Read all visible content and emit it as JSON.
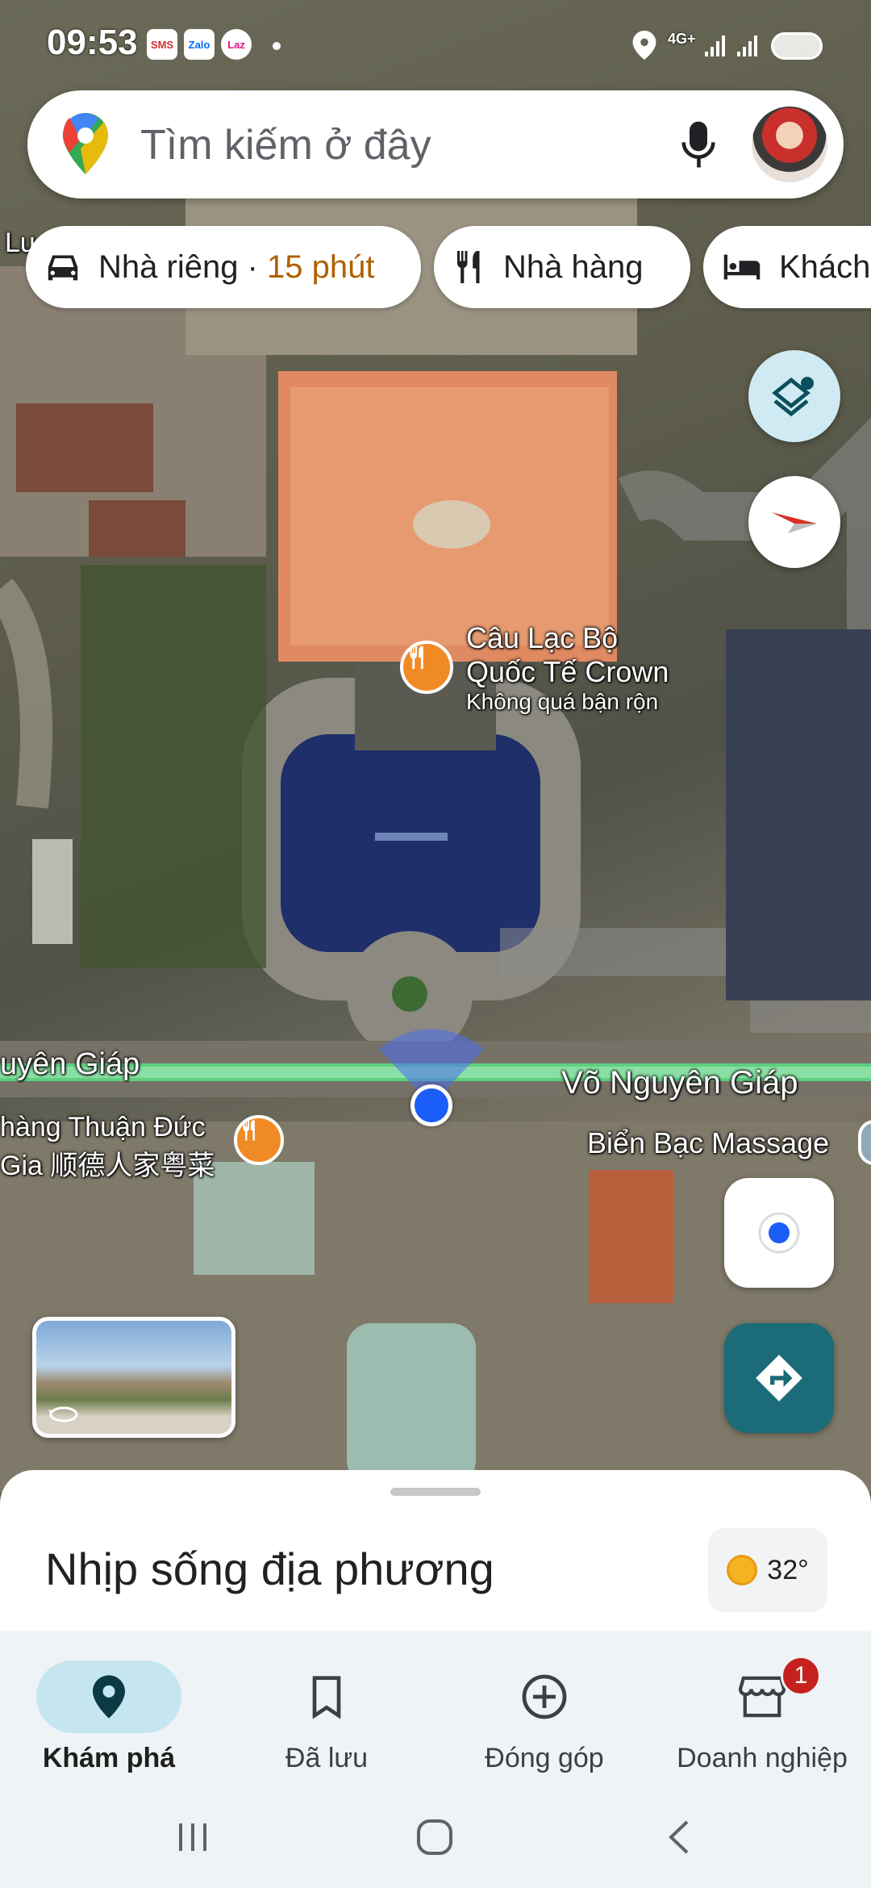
{
  "status_bar": {
    "time": "09:53",
    "notifications": [
      {
        "name": "sms-notification-icon",
        "label": "SMS",
        "color": "#d32f2f"
      },
      {
        "name": "zalo-notification-icon",
        "label": "Zalo",
        "color": "#0068ff"
      },
      {
        "name": "lazada-notification-icon",
        "label": "Laz",
        "color": "#e2137f"
      }
    ],
    "network": "4G+"
  },
  "search": {
    "placeholder": "Tìm kiếm ở đây"
  },
  "chips": {
    "home": {
      "label": "Nhà riêng · ",
      "time": "15 phút"
    },
    "restaurant": {
      "label": "Nhà hàng"
    },
    "hotel": {
      "label": "Khách"
    }
  },
  "map": {
    "poi_crown": {
      "name_line1": "Câu Lạc Bộ",
      "name_line2": "Quốc Tế Crown",
      "status": "Không quá bận rộn"
    },
    "road_left": "uyên Giáp",
    "road_right": "Võ Nguyên Giáp",
    "poi_restaurant_line1": "hàng Thuận Đức",
    "poi_restaurant_line2": "Gia 顺德人家粤菜",
    "poi_massage": "Biển Bạc Massage",
    "edge_label": "Lu"
  },
  "sheet": {
    "title": "Nhịp sống địa phương",
    "temperature": "32°"
  },
  "bottom_nav": {
    "items": [
      {
        "label": "Khám phá",
        "icon": "pin-icon"
      },
      {
        "label": "Đã lưu",
        "icon": "bookmark-icon"
      },
      {
        "label": "Đóng góp",
        "icon": "add-circle-icon"
      },
      {
        "label": "Doanh nghiệp",
        "icon": "store-icon"
      }
    ],
    "business_badge": "1"
  },
  "colors": {
    "accent": "#1b6b78",
    "home_time": "#b06000",
    "route_green": "#5fcf80",
    "location_blue": "#1a5df7"
  }
}
